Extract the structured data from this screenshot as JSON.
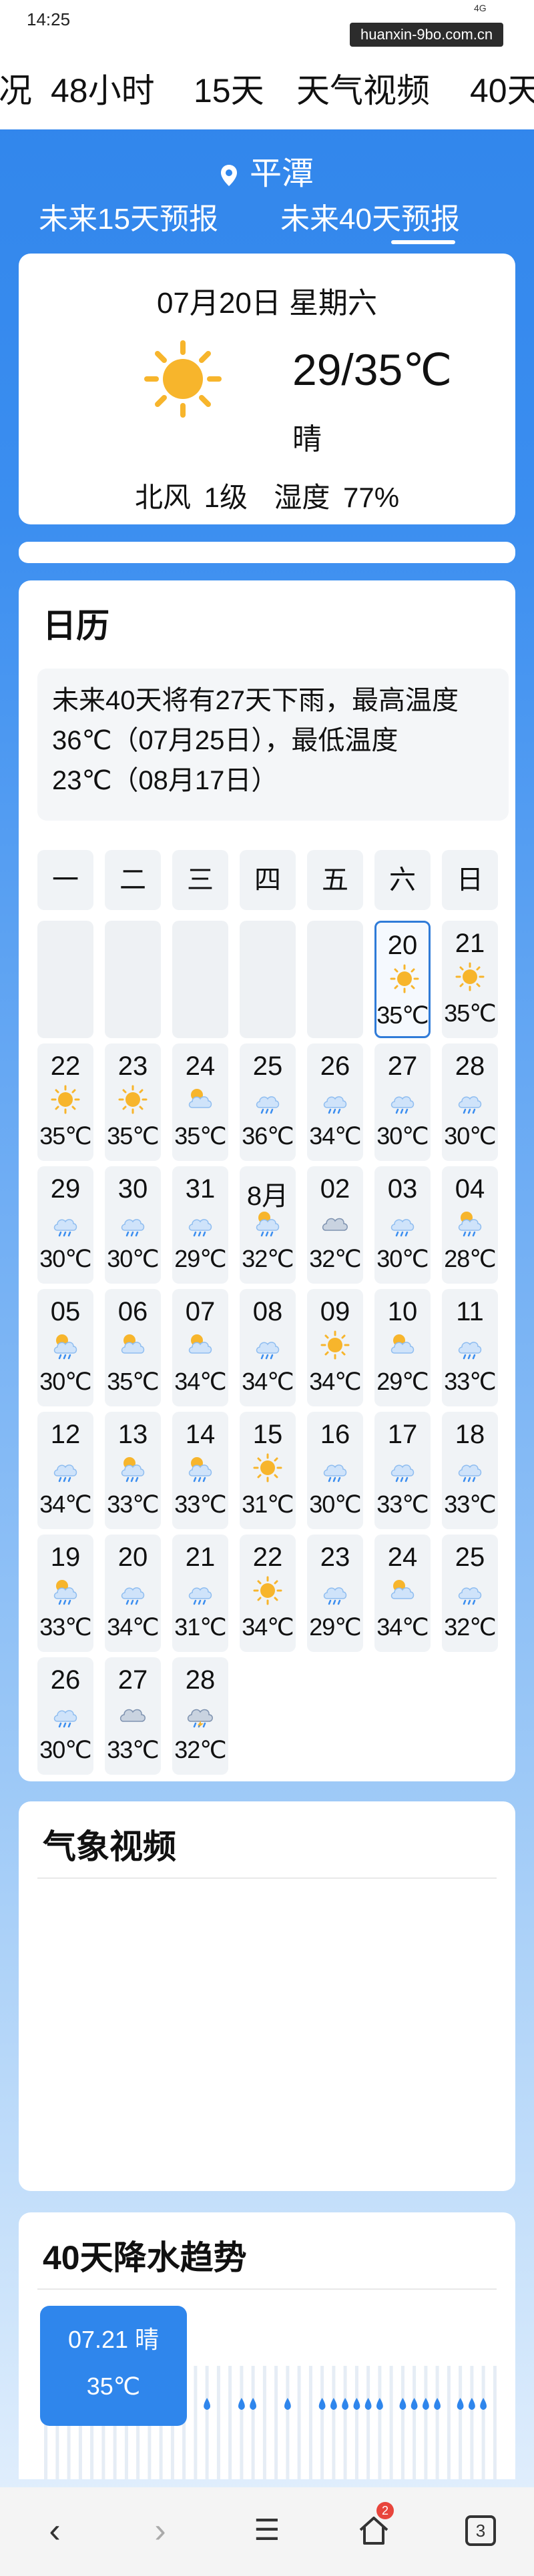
{
  "status": {
    "time": "14:25",
    "signal": "4G",
    "watermark": "huanxin-9bo.com.cn"
  },
  "top_tabs": [
    "况",
    "48小时",
    "15天",
    "天气视频",
    "40天"
  ],
  "location": "平潭",
  "sub_tabs": [
    "未来15天预报",
    "未来40天预报"
  ],
  "today": {
    "date": "07月20日 星期六",
    "temp": "29/35℃",
    "condition": "晴",
    "wind": "北风 1级",
    "humidity": "湿度 77%"
  },
  "calendar": {
    "title": "日历",
    "summary": "未来40天将有27天下雨，最高温度36℃（07月25日），最低温度23℃（08月17日）",
    "weekdays": [
      "一",
      "二",
      "三",
      "四",
      "五",
      "六",
      "日"
    ],
    "leading_blank": 5,
    "selected_index": 0,
    "days": [
      {
        "d": "20",
        "t": "35℃",
        "icon": "sun-icon"
      },
      {
        "d": "21",
        "t": "35℃",
        "icon": "sun-icon"
      },
      {
        "d": "22",
        "t": "35℃",
        "icon": "sun-icon"
      },
      {
        "d": "23",
        "t": "35℃",
        "icon": "sun-icon"
      },
      {
        "d": "24",
        "t": "35℃",
        "icon": "partly-cloudy-icon"
      },
      {
        "d": "25",
        "t": "36℃",
        "icon": "rain-icon"
      },
      {
        "d": "26",
        "t": "34℃",
        "icon": "rain-icon"
      },
      {
        "d": "27",
        "t": "30℃",
        "icon": "rain-icon"
      },
      {
        "d": "28",
        "t": "30℃",
        "icon": "rain-icon"
      },
      {
        "d": "29",
        "t": "30℃",
        "icon": "rain-icon"
      },
      {
        "d": "30",
        "t": "30℃",
        "icon": "rain-icon"
      },
      {
        "d": "31",
        "t": "29℃",
        "icon": "rain-icon"
      },
      {
        "d": "8月",
        "t": "32℃",
        "icon": "sun-rain-icon"
      },
      {
        "d": "02",
        "t": "32℃",
        "icon": "cloudy-icon"
      },
      {
        "d": "03",
        "t": "30℃",
        "icon": "rain-icon"
      },
      {
        "d": "04",
        "t": "28℃",
        "icon": "sun-rain-icon"
      },
      {
        "d": "05",
        "t": "30℃",
        "icon": "sun-rain-icon"
      },
      {
        "d": "06",
        "t": "35℃",
        "icon": "partly-cloudy-icon"
      },
      {
        "d": "07",
        "t": "34℃",
        "icon": "partly-cloudy-icon"
      },
      {
        "d": "08",
        "t": "34℃",
        "icon": "rain-icon"
      },
      {
        "d": "09",
        "t": "34℃",
        "icon": "sun-icon"
      },
      {
        "d": "10",
        "t": "29℃",
        "icon": "partly-cloudy-icon"
      },
      {
        "d": "11",
        "t": "33℃",
        "icon": "rain-icon"
      },
      {
        "d": "12",
        "t": "34℃",
        "icon": "rain-icon"
      },
      {
        "d": "13",
        "t": "33℃",
        "icon": "sun-rain-icon"
      },
      {
        "d": "14",
        "t": "33℃",
        "icon": "sun-rain-icon"
      },
      {
        "d": "15",
        "t": "31℃",
        "icon": "sun-icon"
      },
      {
        "d": "16",
        "t": "30℃",
        "icon": "rain-icon"
      },
      {
        "d": "17",
        "t": "33℃",
        "icon": "rain-icon"
      },
      {
        "d": "18",
        "t": "33℃",
        "icon": "rain-icon"
      },
      {
        "d": "19",
        "t": "33℃",
        "icon": "sun-rain-icon"
      },
      {
        "d": "20",
        "t": "34℃",
        "icon": "rain-icon"
      },
      {
        "d": "21",
        "t": "31℃",
        "icon": "rain-icon"
      },
      {
        "d": "22",
        "t": "34℃",
        "icon": "sun-icon"
      },
      {
        "d": "23",
        "t": "29℃",
        "icon": "rain-icon"
      },
      {
        "d": "24",
        "t": "34℃",
        "icon": "partly-cloudy-icon"
      },
      {
        "d": "25",
        "t": "32℃",
        "icon": "rain-icon"
      },
      {
        "d": "26",
        "t": "30℃",
        "icon": "rain-icon"
      },
      {
        "d": "27",
        "t": "33℃",
        "icon": "cloudy-icon"
      },
      {
        "d": "28",
        "t": "32℃",
        "icon": "thunder-rain-icon"
      }
    ]
  },
  "video": {
    "title": "气象视频"
  },
  "trend": {
    "title": "40天降水趋势",
    "tooltip_date": "07.21 晴",
    "tooltip_temp": "35℃",
    "rain_days": [
      0,
      1,
      1,
      1,
      1,
      1,
      1,
      1,
      1,
      1,
      1,
      1,
      0,
      0,
      1,
      0,
      0,
      1,
      1,
      0,
      0,
      1,
      0,
      0,
      1,
      1,
      1,
      1,
      1,
      1,
      0,
      1,
      1,
      1,
      1,
      0,
      1,
      1,
      1,
      0
    ]
  },
  "bottom_nav": {
    "back": "‹",
    "forward": "›",
    "menu": "☰",
    "home_badge": "2",
    "tabs_count": "3"
  },
  "colors": {
    "primary": "#2f86ec",
    "sun": "#f7b52c",
    "rain_drop": "#2f86ec"
  }
}
